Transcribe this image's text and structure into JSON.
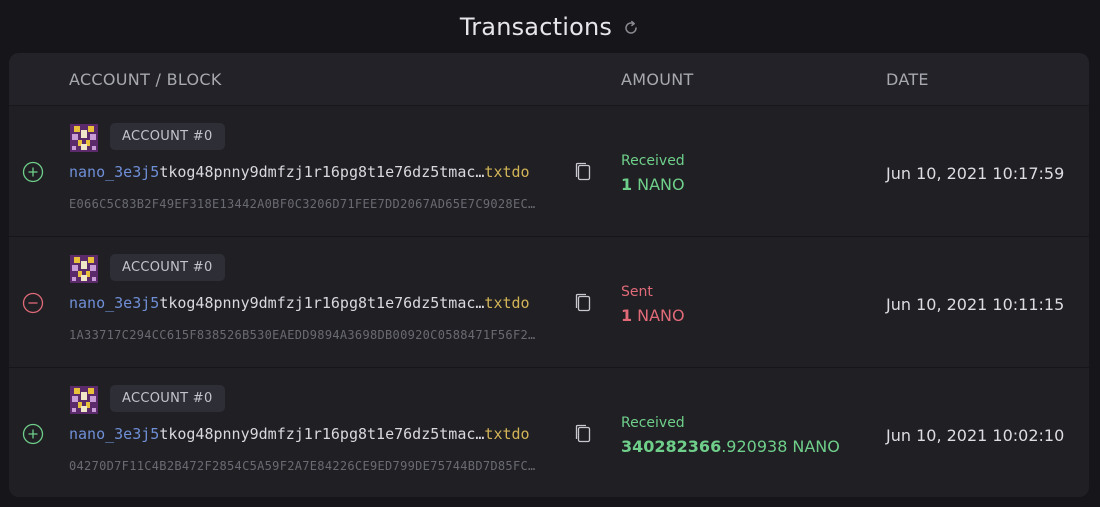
{
  "header": {
    "title": "Transactions",
    "refresh_icon": "refresh-icon"
  },
  "table": {
    "columns": {
      "account_block": "ACCOUNT / BLOCK",
      "amount": "AMOUNT",
      "date": "DATE"
    },
    "rows": [
      {
        "direction": "received",
        "direction_icon": "plus-circle-icon",
        "account_label": "ACCOUNT #0",
        "address_prefix": "nano_3e3j5",
        "address_middle": "tkog48pnny9dmfzj1r16pg8t1e76dz5tmac…",
        "address_suffix": "txtdo",
        "block_hash": "E066C5C83B2F49EF318E13442A0BF0C3206D71FEE7DD2067AD65E7C9028EC…",
        "type_label": "Received",
        "amount_int": "1",
        "amount_frac": "",
        "amount_unit": "NANO",
        "date": "Jun 10, 2021 10:17:59"
      },
      {
        "direction": "sent",
        "direction_icon": "minus-circle-icon",
        "account_label": "ACCOUNT #0",
        "address_prefix": "nano_3e3j5",
        "address_middle": "tkog48pnny9dmfzj1r16pg8t1e76dz5tmac…",
        "address_suffix": "txtdo",
        "block_hash": "1A33717C294CC615F838526B530EAEDD9894A3698DB00920C0588471F56F2…",
        "type_label": "Sent",
        "amount_int": "1",
        "amount_frac": "",
        "amount_unit": "NANO",
        "date": "Jun 10, 2021 10:11:15"
      },
      {
        "direction": "received",
        "direction_icon": "plus-circle-icon",
        "account_label": "ACCOUNT #0",
        "address_prefix": "nano_3e3j5",
        "address_middle": "tkog48pnny9dmfzj1r16pg8t1e76dz5tmac…",
        "address_suffix": "txtdo",
        "block_hash": "04270D7F11C4B2B472F2854C5A59F2A7E84226CE9ED799DE75744BD7D85FC…",
        "type_label": "Received",
        "amount_int": "340282366",
        "amount_frac": ".920938",
        "amount_unit": "NANO",
        "date": "Jun 10, 2021 10:02:10"
      }
    ]
  },
  "colors": {
    "received": "#6fcf8a",
    "sent": "#e06a78",
    "address_prefix": "#6f8fd6",
    "address_suffix": "#d2b457"
  }
}
